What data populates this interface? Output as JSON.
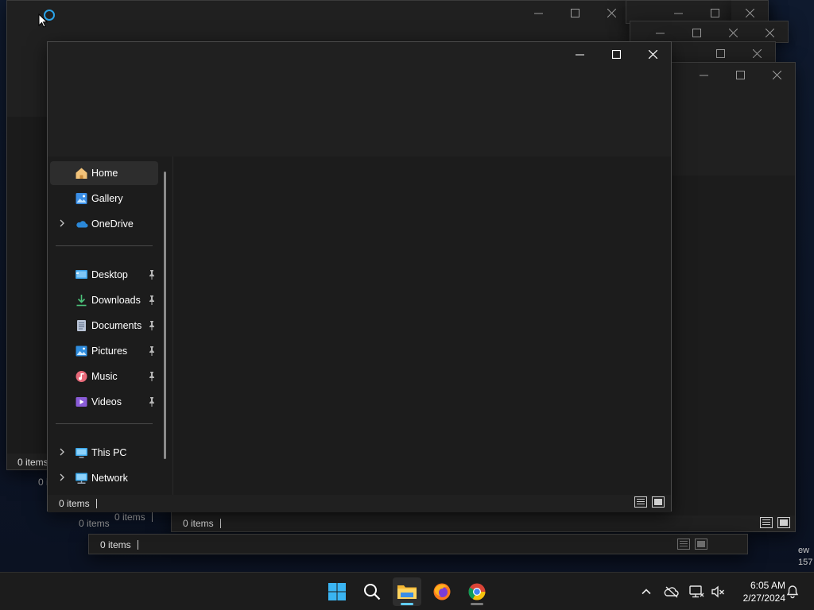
{
  "colors": {
    "accent": "#60cdff",
    "window_bg": "#202020",
    "taskbar_bg": "#1c1c1c"
  },
  "background_windows": [
    {
      "status": "0 items"
    },
    {
      "status": "0 items"
    },
    {
      "status": "0 items"
    },
    {
      "status": "0 items"
    },
    {
      "status": "0 items"
    },
    {
      "status": "0 items"
    }
  ],
  "explorer": {
    "nav_groups": {
      "top": [
        {
          "label": "Home",
          "icon": "home-icon",
          "expandable": false,
          "active": true
        },
        {
          "label": "Gallery",
          "icon": "gallery-icon",
          "expandable": false,
          "active": false
        },
        {
          "label": "OneDrive",
          "icon": "onedrive-icon",
          "expandable": true,
          "active": false
        }
      ],
      "quick_access": [
        {
          "label": "Desktop",
          "icon": "desktop-folder-icon",
          "pinned": true
        },
        {
          "label": "Downloads",
          "icon": "downloads-icon",
          "pinned": true
        },
        {
          "label": "Documents",
          "icon": "documents-icon",
          "pinned": true
        },
        {
          "label": "Pictures",
          "icon": "pictures-icon",
          "pinned": true
        },
        {
          "label": "Music",
          "icon": "music-icon",
          "pinned": true
        },
        {
          "label": "Videos",
          "icon": "videos-icon",
          "pinned": true
        }
      ],
      "bottom": [
        {
          "label": "This PC",
          "icon": "this-pc-icon",
          "expandable": true
        },
        {
          "label": "Network",
          "icon": "network-icon",
          "expandable": true
        }
      ]
    },
    "status": "0 items"
  },
  "right_edge_text": {
    "line1": "ew",
    "line2": "157"
  },
  "taskbar": {
    "apps": [
      {
        "name": "start-button",
        "icon": "windows-logo-icon"
      },
      {
        "name": "search-button",
        "icon": "search-icon"
      },
      {
        "name": "file-explorer-app",
        "icon": "file-explorer-icon"
      },
      {
        "name": "firefox-app",
        "icon": "firefox-icon"
      },
      {
        "name": "chrome-app",
        "icon": "chrome-icon"
      }
    ],
    "time": "6:05 AM",
    "date": "2/27/2024"
  }
}
